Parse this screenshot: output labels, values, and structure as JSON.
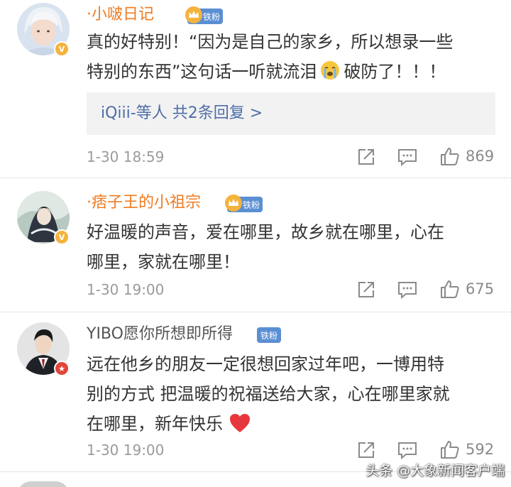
{
  "comments": [
    {
      "username": "·小啵日记",
      "fan_badge": "铁粉",
      "text_lines": [
        "真的好特别！“因为是自己的家乡，所以想录一些",
        "特别的东西”这句话一听就流泪",
        "破防了！！！"
      ],
      "reply_users": "iQiii-等人",
      "reply_count": "共2条回复 >",
      "time": "1-30 18:59",
      "likes": "869"
    },
    {
      "username": "·痞子王的小祖宗",
      "fan_badge": "铁粉",
      "text_lines": [
        "好温暖的声音，爱在哪里，故乡就在哪里，心在",
        "哪里，家就在哪里！"
      ],
      "time": "1-30 19:00",
      "likes": "675"
    },
    {
      "username": "YIBO愿你所想即所得",
      "fan_badge": "铁粉",
      "text_lines": [
        "远在他乡的朋友一定很想回家过年吧，一博用特",
        "别的方式 把温暖的祝福送给大家，心在哪里家就",
        "在哪里，新年快乐"
      ],
      "time": "1-30 19:00",
      "likes": "592"
    }
  ],
  "watermark": "头条 @大象新闻客户端",
  "colors": {
    "username_orange": "#ef7b21",
    "fan_badge_blue": "#5b8fd4",
    "reply_blue": "#4e6ea8",
    "verified_gold": "#f4b33c",
    "verified_red": "#e0463a"
  },
  "icons": [
    "share-icon",
    "comment-icon",
    "like-icon",
    "crying-emoji-icon",
    "red-heart-icon",
    "crown-icon"
  ]
}
